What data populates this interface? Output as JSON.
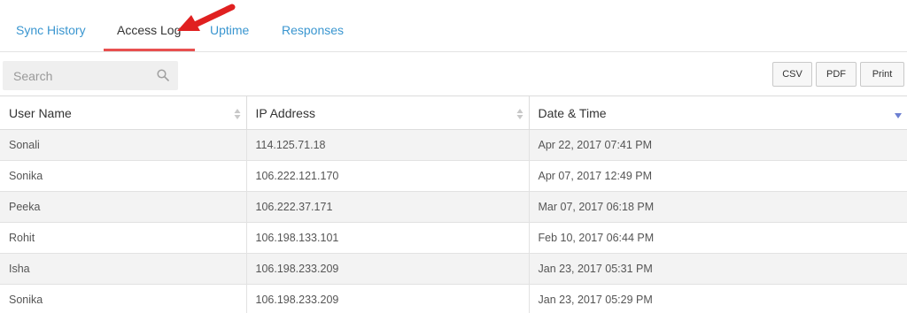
{
  "tabs": [
    {
      "label": "Sync History",
      "active": false
    },
    {
      "label": "Access Log",
      "active": true
    },
    {
      "label": "Uptime",
      "active": false
    },
    {
      "label": "Responses",
      "active": false
    }
  ],
  "search": {
    "placeholder": "Search",
    "icon": "search-icon"
  },
  "export_buttons": {
    "csv": "CSV",
    "pdf": "PDF",
    "print": "Print"
  },
  "table": {
    "columns": [
      "User Name",
      "IP Address",
      "Date & Time"
    ],
    "sorted_column": "Date & Time",
    "sort_direction": "descending",
    "rows": [
      {
        "user": "Sonali",
        "ip": "114.125.71.18",
        "datetime": "Apr 22, 2017 07:41 PM"
      },
      {
        "user": "Sonika",
        "ip": "106.222.121.170",
        "datetime": "Apr 07, 2017 12:49 PM"
      },
      {
        "user": "Peeka",
        "ip": "106.222.37.171",
        "datetime": "Mar 07, 2017 06:18 PM"
      },
      {
        "user": "Rohit",
        "ip": "106.198.133.101",
        "datetime": "Feb 10, 2017 06:44 PM"
      },
      {
        "user": "Isha",
        "ip": "106.198.233.209",
        "datetime": "Jan 23, 2017 05:31 PM"
      },
      {
        "user": "Sonika",
        "ip": "106.198.233.209",
        "datetime": "Jan 23, 2017 05:29 PM"
      }
    ]
  },
  "colors": {
    "tab_link": "#3a96d0",
    "active_underline": "#e8504f",
    "annotation_arrow": "#e02020",
    "sort_indicator": "#6c7fd1"
  }
}
